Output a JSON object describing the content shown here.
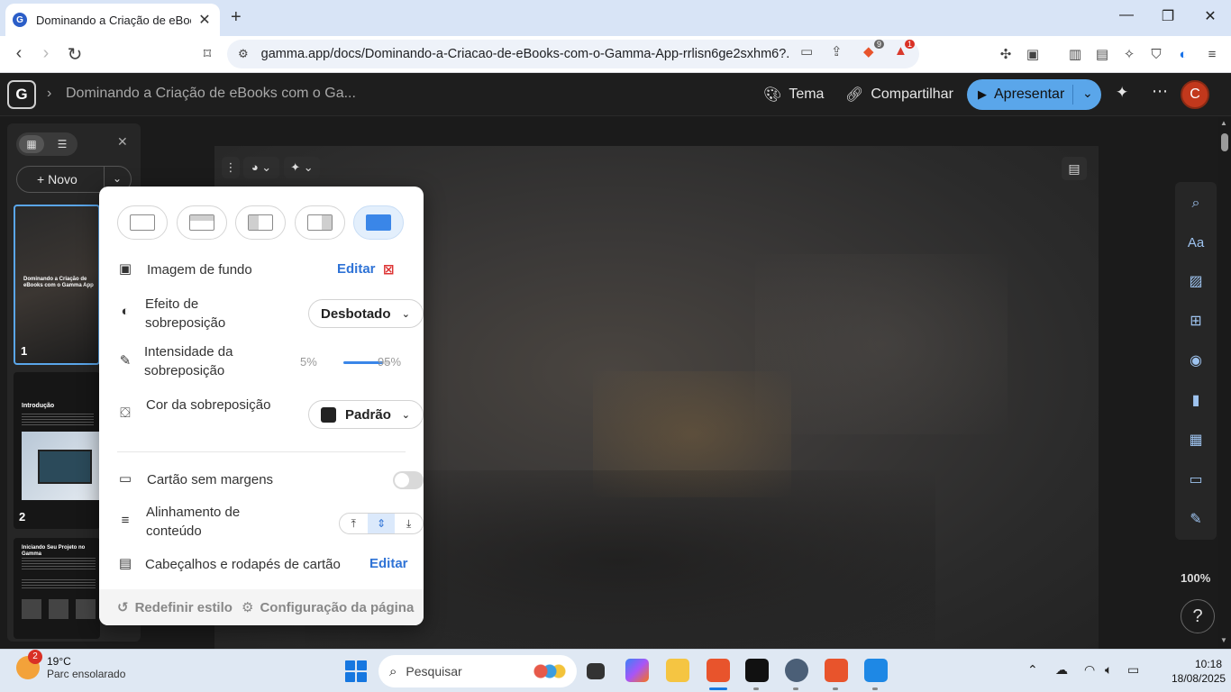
{
  "browser": {
    "tab_title": "Dominando a Criação de eBooks",
    "favicon_letter": "G",
    "url": "gamma.app/docs/Dominando-a-Criacao-de-eBooks-com-o-Gamma-App-rrlisn6ge2sxhm6?...",
    "brave_count": "9",
    "alert_count": "1"
  },
  "app": {
    "logo_letter": "G",
    "doc_title": "Dominando a Criação de eBooks com o Ga...",
    "theme_label": "Tema",
    "share_label": "Compartilhar",
    "present_label": "Apresentar",
    "avatar_letter": "C"
  },
  "left_panel": {
    "new_label": "Novo",
    "thumbnails": [
      {
        "number": "1",
        "title": "Dominando a Criação de eBooks com o Gamma App"
      },
      {
        "number": "2",
        "title": "Introdução"
      },
      {
        "number": "",
        "title": "Iniciando Seu Projeto no Gamma"
      }
    ]
  },
  "style_panel": {
    "background_image_label": "Imagem de fundo",
    "edit_label": "Editar",
    "overlay_effect_label": "Efeito de sobreposição",
    "overlay_effect_value": "Desbotado",
    "overlay_intensity_label": "Intensidade da sobreposição",
    "slider_min_label": "5%",
    "slider_max_label": "95%",
    "slider_value_fraction": 0.85,
    "overlay_color_label": "Cor da sobreposição",
    "overlay_color_value": "Padrão",
    "overlay_color_swatch": "#222222",
    "borderless_card_label": "Cartão sem margens",
    "borderless_card_on": false,
    "content_alignment_label": "Alinhamento de conteúdo",
    "content_alignment_selected": "middle",
    "headers_footers_label": "Cabeçalhos e rodapés de cartão",
    "headers_footers_edit": "Editar",
    "reset_style_label": "Redefinir estilo",
    "page_setup_label": "Configuração da página",
    "selected_layout": "full-background"
  },
  "right_rail": {
    "zoom": "100%",
    "help": "?"
  },
  "taskbar": {
    "weather_temp": "19°C",
    "weather_condition": "Parc ensolarado",
    "weather_badge": "2",
    "search_placeholder": "Pesquisar",
    "time": "10:18",
    "date": "18/08/2025"
  },
  "colors": {
    "accent": "#3a86e8",
    "present_button": "#5aa6ea",
    "avatar": "#c2381c"
  }
}
